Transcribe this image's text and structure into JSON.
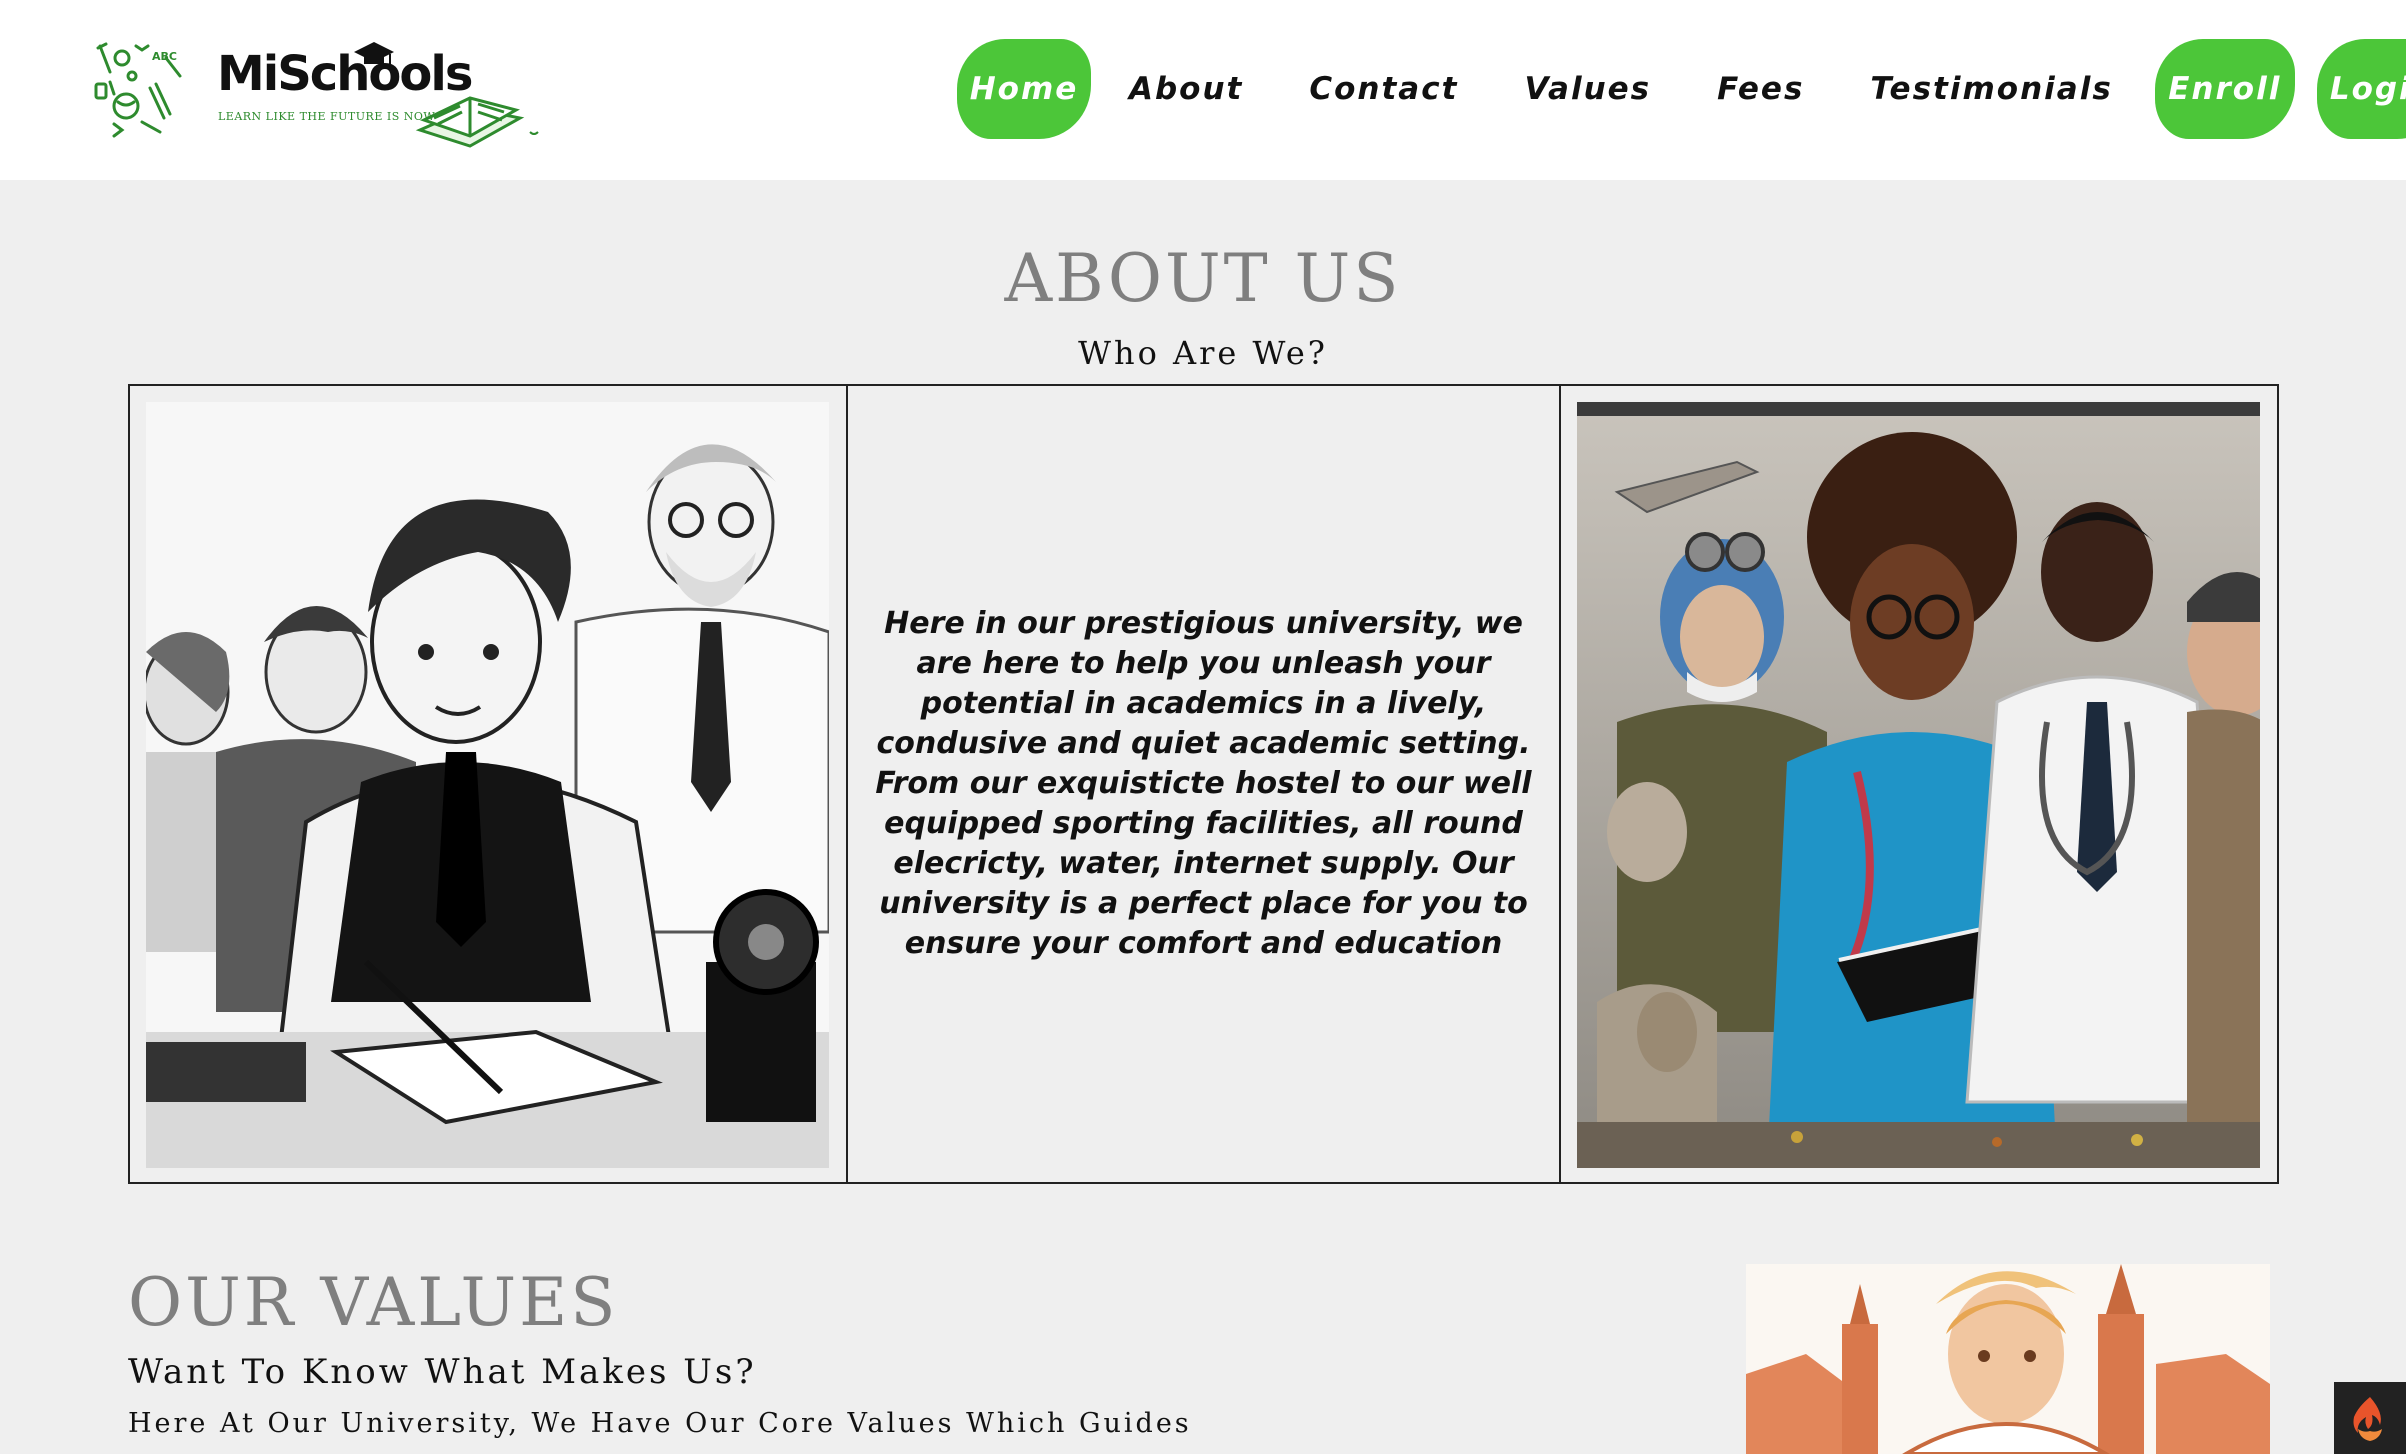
{
  "brand": {
    "name": "MiSchools",
    "tagline": "LEARN LIKE THE FUTURE IS NOW",
    "accent_color": "#4cc639"
  },
  "nav": {
    "items": [
      {
        "label": "Home",
        "active": true
      },
      {
        "label": "About"
      },
      {
        "label": "Contact"
      },
      {
        "label": "Values"
      },
      {
        "label": "Fees"
      },
      {
        "label": "Testimonials"
      }
    ],
    "enroll": "Enroll",
    "login": "Login"
  },
  "about": {
    "title": "ABOUT US",
    "subtitle": "Who Are We?",
    "body": "Here in our prestigious university, we are here to help you unleash your potential in academics in a lively, condusive and quiet academic setting. From our exquisticte hostel to our well equipped sporting facilities, all round elecricty, water, internet supply. Our university is a perfect place for you to ensure your comfort and education",
    "left_image": "students-sketch-illustration",
    "right_image": "professions-mural-illustration"
  },
  "values": {
    "title": "OUR VALUES",
    "subtitle": "Want To Know What Makes Us?",
    "text": "Here At Our University, We Have Our Core Values Which Guides",
    "image": "student-city-illustration"
  },
  "widget": {
    "icon": "flame-icon"
  }
}
